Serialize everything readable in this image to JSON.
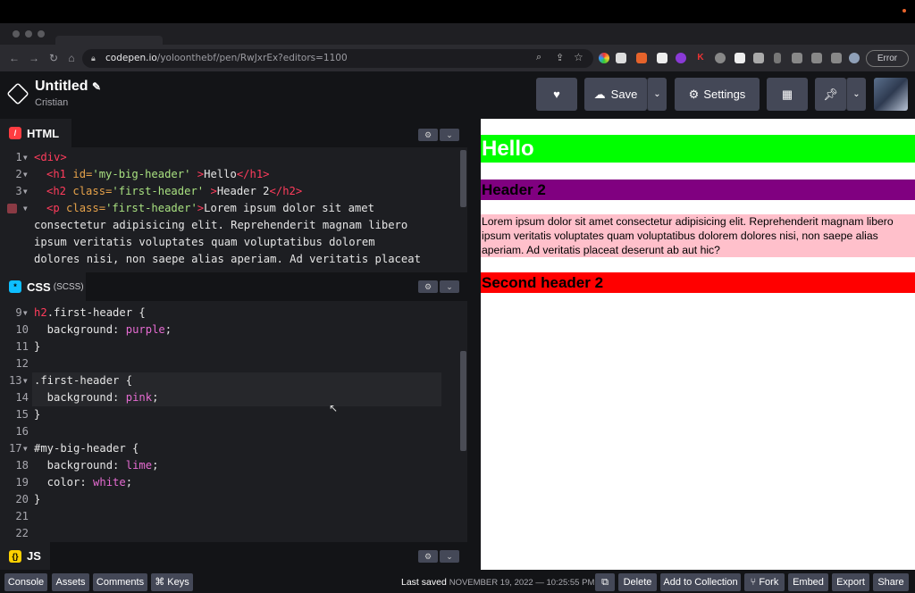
{
  "browser": {
    "tab_title": "...",
    "url_host": "codepen.io",
    "url_path": "/yoloonthebf/pen/RwJxrEx?editors=1100",
    "error_label": "Error"
  },
  "header": {
    "pen_title": "Untitled",
    "author": "Cristian",
    "save_label": "Save",
    "settings_label": "Settings"
  },
  "html_pane": {
    "label": "HTML",
    "lines": [
      {
        "num": "1"
      },
      {
        "num": "2"
      },
      {
        "num": "3"
      },
      {
        "num": ""
      }
    ],
    "wrap_text": [
      "consectetur adipisicing elit. Reprehenderit magnam libero",
      "ipsum veritatis voluptates quam voluptatibus dolorem",
      "dolores nisi, non saepe alias aperiam. Ad veritatis placeat"
    ]
  },
  "css_pane": {
    "label": "CSS",
    "sublabel": "(SCSS)",
    "line_numbers": [
      "9",
      "10",
      "11",
      "12",
      "13",
      "14",
      "15",
      "16",
      "17",
      "18",
      "19",
      "20",
      "21",
      "22"
    ]
  },
  "js_pane": {
    "label": "JS"
  },
  "preview": {
    "h1": "Hello",
    "h2_first": "Header 2",
    "paragraph": "Lorem ipsum dolor sit amet consectetur adipisicing elit. Reprehenderit magnam libero ipsum veritatis voluptates quam voluptatibus dolorem dolores nisi, non saepe alias aperiam. Ad veritatis placeat deserunt ab aut hic?",
    "h2_second": "Second header 2",
    "colors": {
      "lime": "#00ff00",
      "purple": "#800080",
      "pink": "#ffc0cb",
      "red": "#ff0000"
    }
  },
  "footer": {
    "console": "Console",
    "assets": "Assets",
    "comments": "Comments",
    "keys": "⌘ Keys",
    "last_saved_label": "Last saved",
    "last_saved_time": "NOVEMBER 19, 2022 — 10:25:55 PM",
    "delete": "Delete",
    "add_to_collection": "Add to Collection",
    "fork": "Fork",
    "embed": "Embed",
    "export": "Export",
    "share": "Share"
  }
}
